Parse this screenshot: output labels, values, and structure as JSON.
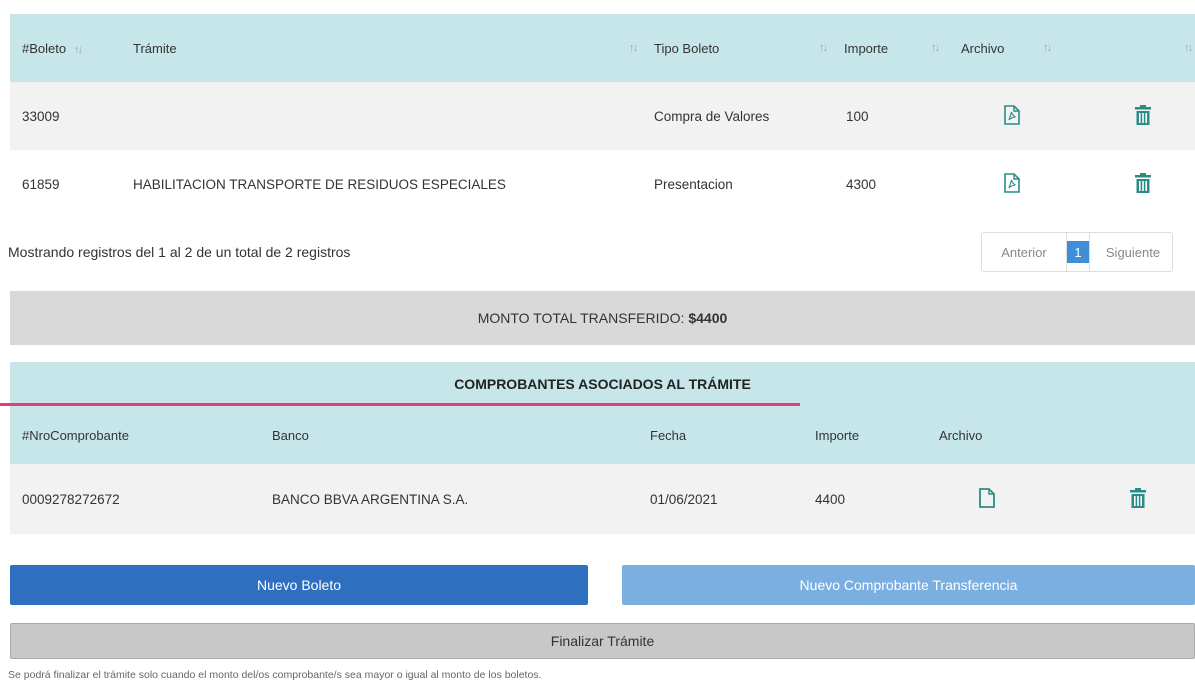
{
  "boletos_table": {
    "headers": [
      "#Boleto",
      "Trámite",
      "Tipo Boleto",
      "Importe",
      "Archivo"
    ],
    "sort_glyph": "↑↓",
    "rows": [
      {
        "boleto": "33009",
        "tramite": "",
        "tipo": "Compra de Valores",
        "importe": "100"
      },
      {
        "boleto": "61859",
        "tramite": "HABILITACION TRANSPORTE DE RESIDUOS ESPECIALES",
        "tipo": "Presentacion",
        "importe": "4300"
      }
    ]
  },
  "table_info": "Mostrando registros del 1 al 2 de un total de 2 registros",
  "pagination": {
    "previous": "Anterior",
    "current_page": "1",
    "next": "Siguiente"
  },
  "total": {
    "label": "MONTO TOTAL TRANSFERIDO:",
    "value": "$4400"
  },
  "comprobantes": {
    "title": "COMPROBANTES ASOCIADOS AL TRÁMITE",
    "headers": [
      "#NroComprobante",
      "Banco",
      "Fecha",
      "Importe",
      "Archivo"
    ],
    "rows": [
      {
        "nro": "0009278272672",
        "banco": "BANCO BBVA ARGENTINA S.A.",
        "fecha": "01/06/2021",
        "importe": "4400"
      }
    ]
  },
  "buttons": {
    "nuevo_boleto": "Nuevo Boleto",
    "nuevo_comprobante": "Nuevo Comprobante Transferencia",
    "finalizar": "Finalizar Trámite"
  },
  "footnote": "Se podrá finalizar el trámite solo cuando el monto del/os comprobante/s sea mayor o igual al monto de los boletos.",
  "icons": {
    "pdf": "pdf-file-icon",
    "file": "file-icon",
    "delete": "trash-icon"
  },
  "colors": {
    "header_bg": "#c6e6ea",
    "primary_button": "#2f6fbf",
    "secondary_button": "#7aafe0",
    "icon_teal": "#2a8c86",
    "accent_line": "#e63a7a"
  }
}
